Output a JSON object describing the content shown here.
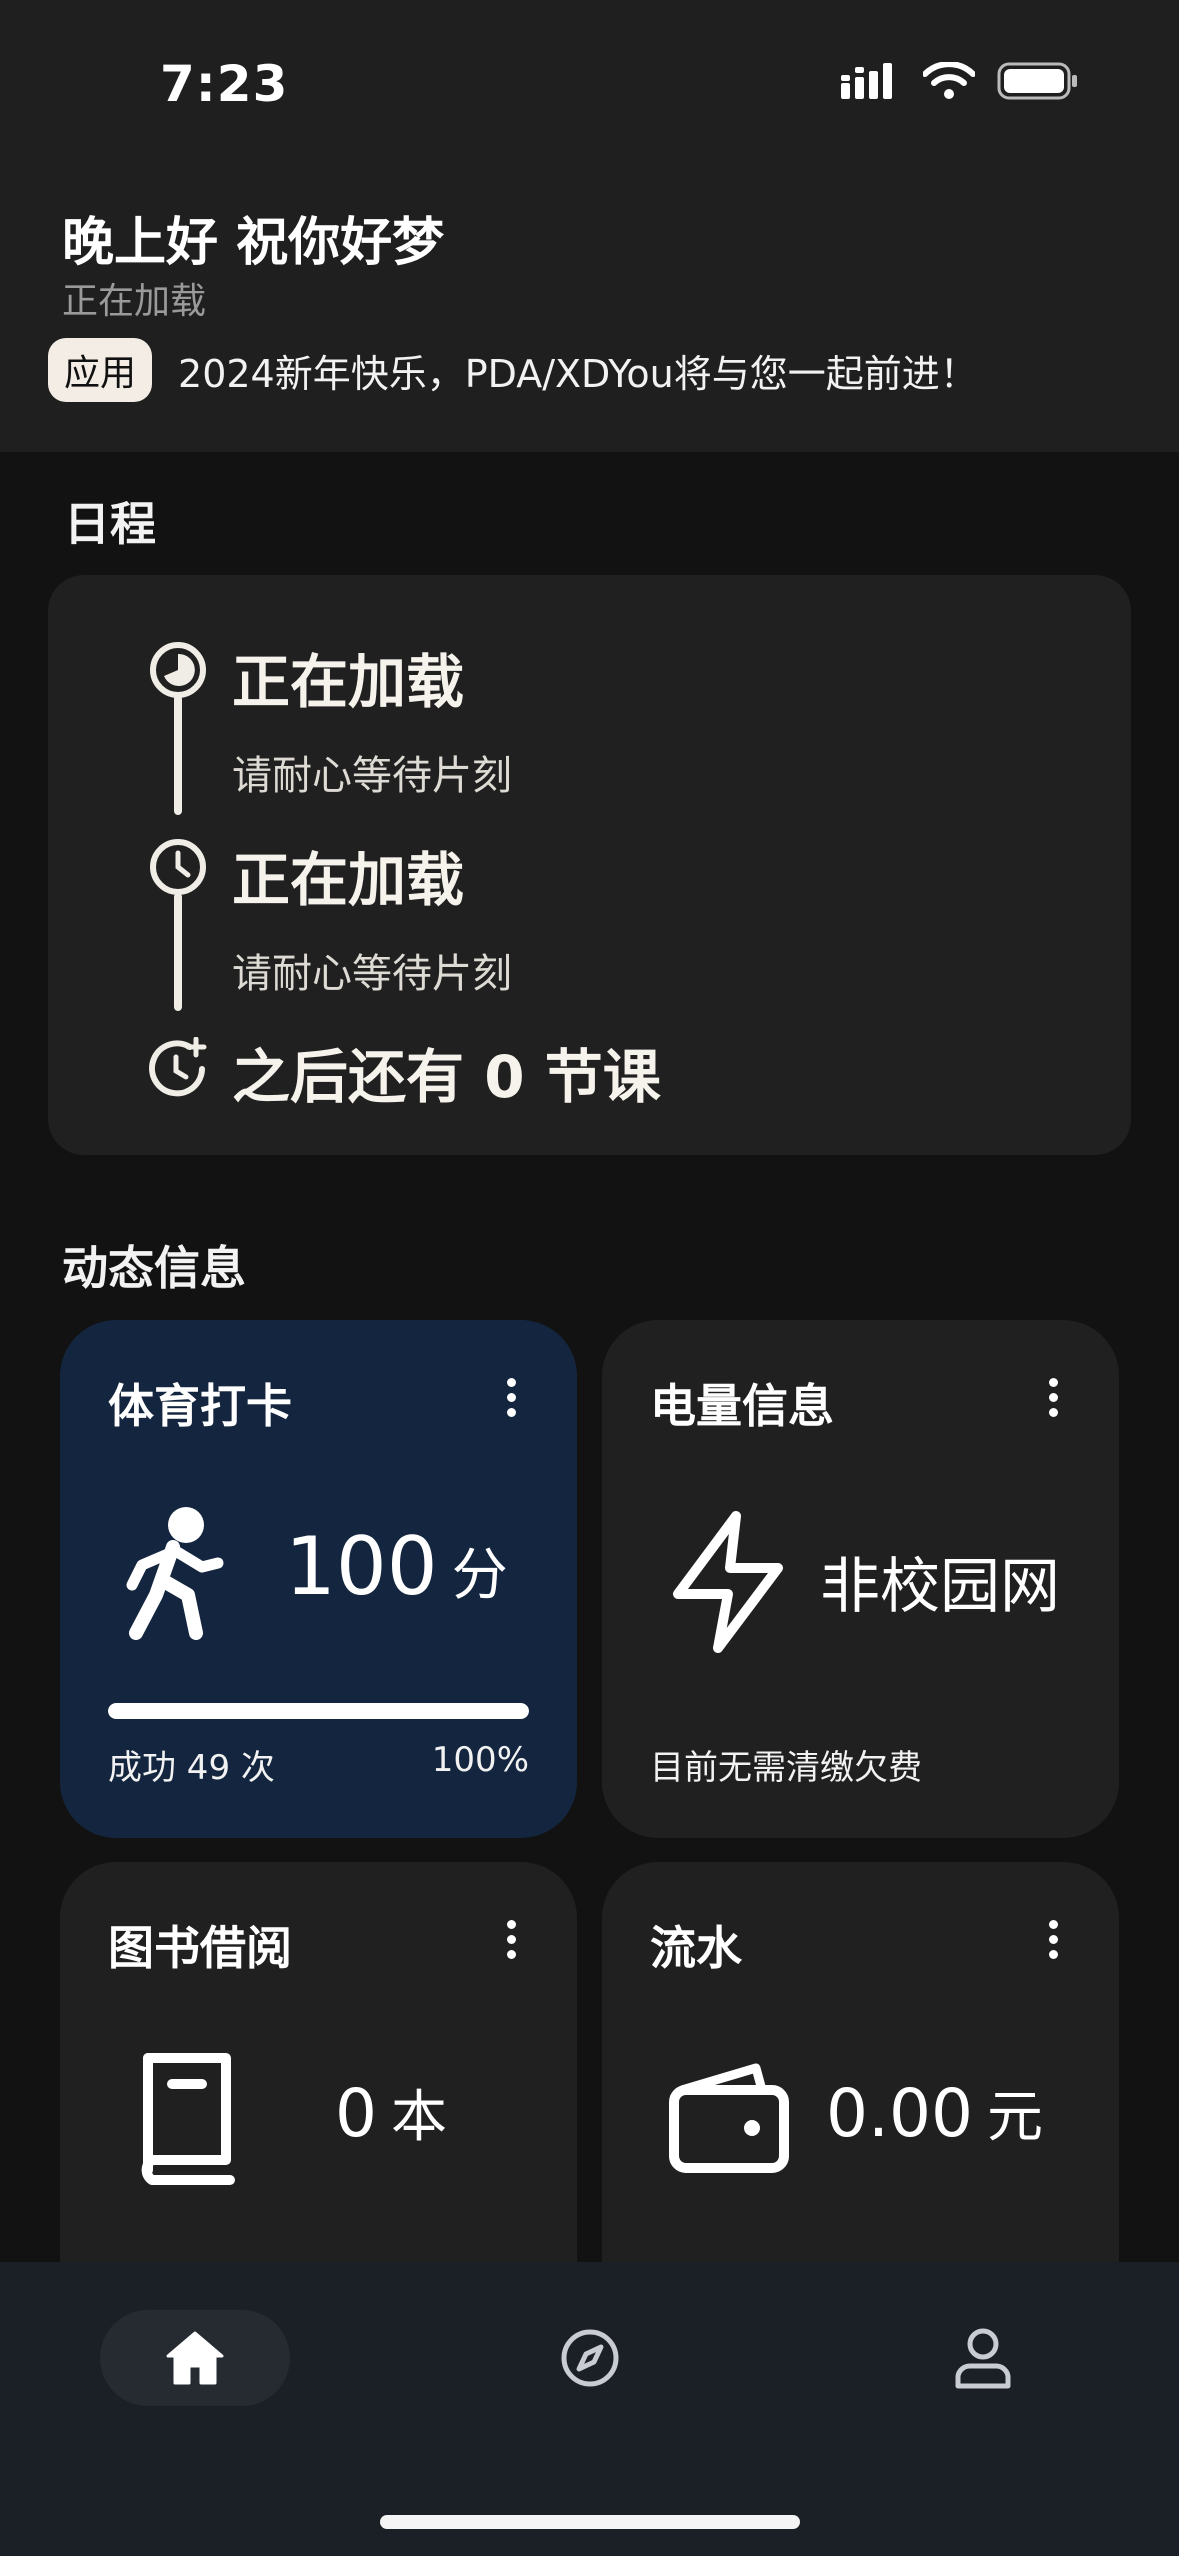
{
  "status_bar": {
    "time": "7:23"
  },
  "header": {
    "greeting": "晚上好 祝你好梦",
    "subtitle": "正在加载",
    "notice_badge": "应用",
    "notice_text": "2024新年快乐，PDA/XDYou将与您一起前进！"
  },
  "schedule": {
    "section_title": "日程",
    "items": [
      {
        "title": "正在加载",
        "subtitle": "请耐心等待片刻",
        "icon": "timelapse-icon"
      },
      {
        "title": "正在加载",
        "subtitle": "请耐心等待片刻",
        "icon": "clock-icon"
      }
    ],
    "footer": "之后还有 0 节课"
  },
  "dynamic": {
    "section_title": "动态信息",
    "sports": {
      "title": "体育打卡",
      "value": "100",
      "unit": "分",
      "footer_left": "成功 49 次",
      "footer_right": "100%",
      "progress": 1.0,
      "icon": "running-icon"
    },
    "electricity": {
      "title": "电量信息",
      "value": "非校园网",
      "footer": "目前无需清缴欠费",
      "icon": "lightning-icon"
    },
    "library": {
      "title": "图书借阅",
      "value": "0",
      "unit": "本",
      "icon": "book-icon"
    },
    "transactions": {
      "title": "流水",
      "value": "0.00",
      "unit": "元",
      "icon": "wallet-icon"
    }
  },
  "bottom_nav": {
    "items": [
      {
        "name": "home",
        "icon": "home-icon",
        "active": true
      },
      {
        "name": "explore",
        "icon": "compass-icon",
        "active": false
      },
      {
        "name": "profile",
        "icon": "person-icon",
        "active": false
      }
    ]
  },
  "colors": {
    "background": "#121212",
    "header": "#1f1f1f",
    "card": "#202020",
    "sports_card": "#14263f",
    "nav": "#1b1f26"
  }
}
